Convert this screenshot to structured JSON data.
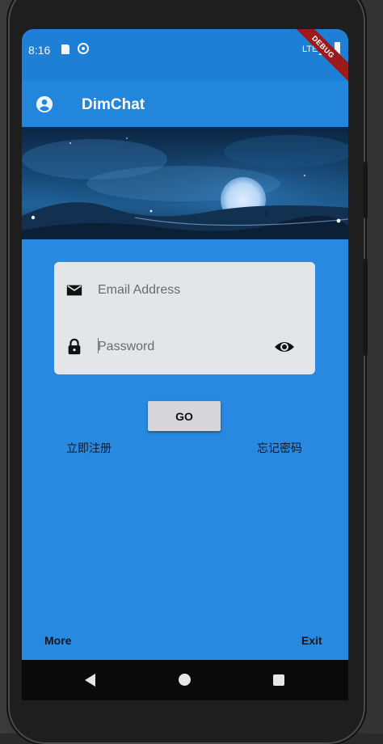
{
  "status_bar": {
    "time": "8:16",
    "network": "LTE",
    "debug_label": "DEBUG"
  },
  "app_bar": {
    "title": "DimChat",
    "leading_icon": "account-circle-icon"
  },
  "login_form": {
    "email_placeholder": "Email Address",
    "email_icon": "mail-icon",
    "password_placeholder": "Password",
    "password_icon": "lock-icon",
    "visibility_icon": "eye-icon"
  },
  "actions": {
    "register_label": "立即注册",
    "go_label": "GO",
    "forgot_label": "忘记密码"
  },
  "footer": {
    "more_label": "More",
    "exit_label": "Exit"
  },
  "colors": {
    "primary": "#2286dc",
    "background": "#2889e0",
    "card": "#e4e5e8",
    "debug_banner": "#9b1b1b"
  }
}
